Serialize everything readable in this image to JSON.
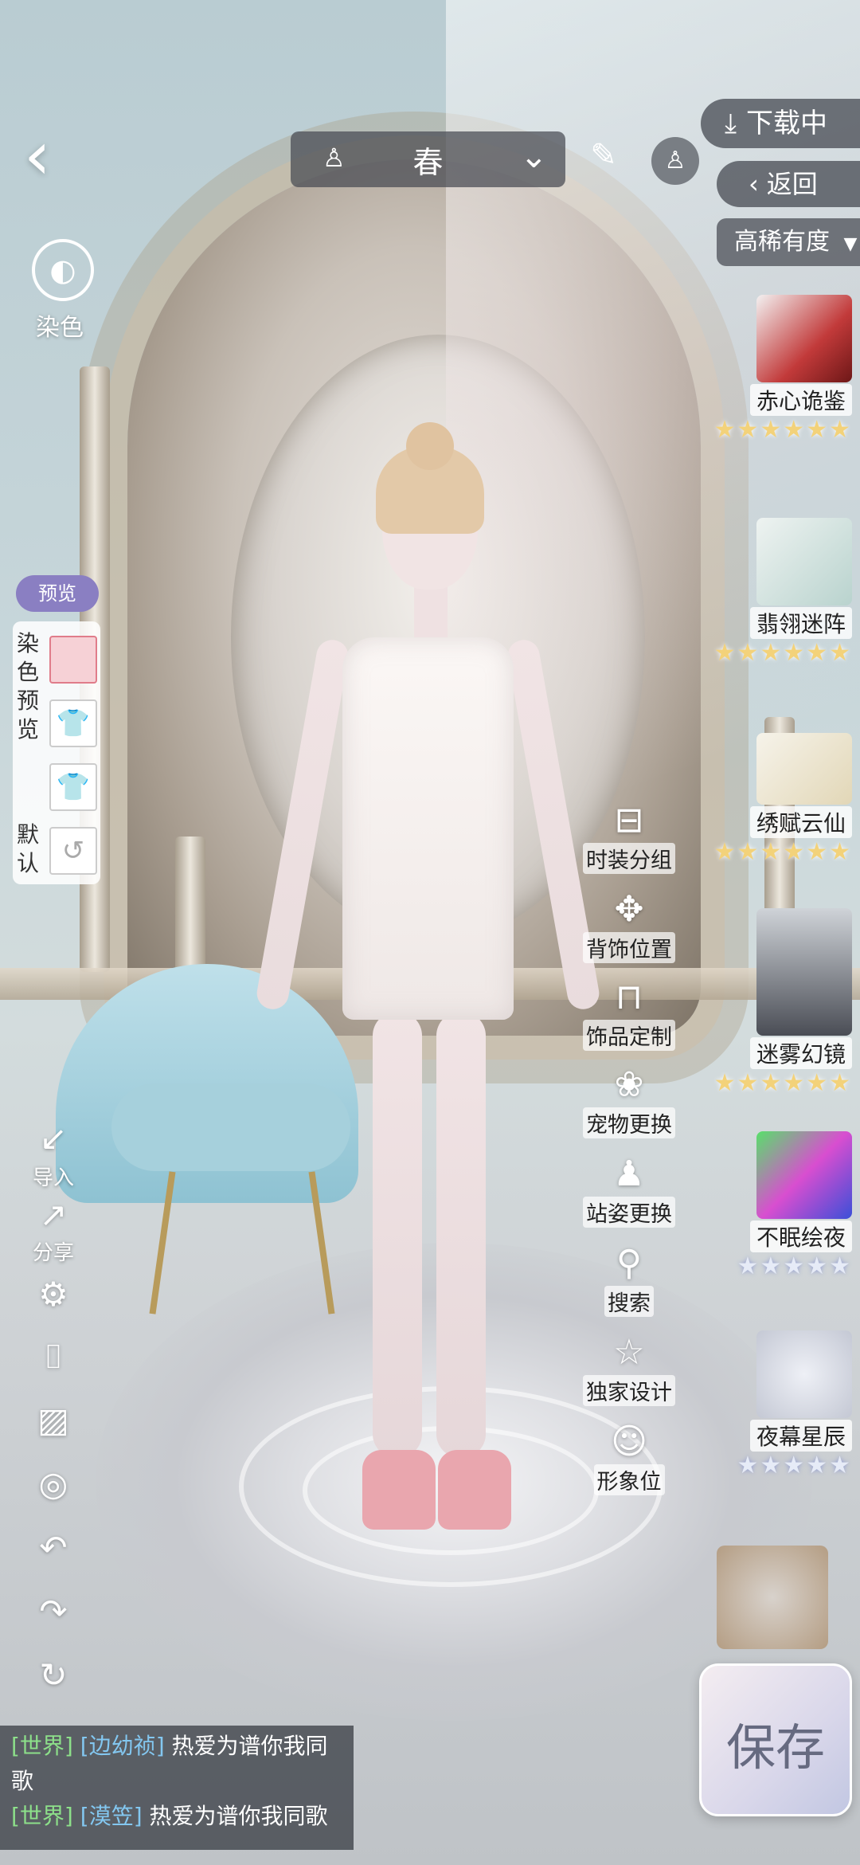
{
  "top_bar": {
    "season": "春",
    "download_label": "下载中",
    "return_label": "返回",
    "rarity_label": "高稀有度"
  },
  "left_tools": {
    "dye_label": "染色",
    "preview_label": "预览",
    "dye_preview_label": "染色预览",
    "default_label": "默认",
    "import_label": "导入",
    "share_label": "分享"
  },
  "center_menu": [
    {
      "label": "时装分组",
      "icon": "hanger-icon"
    },
    {
      "label": "背饰位置",
      "icon": "wing-position-icon"
    },
    {
      "label": "饰品定制",
      "icon": "bag-icon"
    },
    {
      "label": "宠物更换",
      "icon": "paw-icon"
    },
    {
      "label": "站姿更换",
      "icon": "person-icon"
    },
    {
      "label": "搜索",
      "icon": "search-icon"
    },
    {
      "label": "独家设计",
      "icon": "star-icon"
    },
    {
      "label": "形象位",
      "icon": "portrait-icon"
    }
  ],
  "collections": [
    {
      "name": "赤心诡鉴",
      "stars": "★★★★★★",
      "tier": "gold"
    },
    {
      "name": "翡翎迷阵",
      "stars": "★★★★★★",
      "tier": "gold"
    },
    {
      "name": "绣赋云仙",
      "stars": "★★★★★★",
      "tier": "gold"
    },
    {
      "name": "迷雾幻镜",
      "stars": "★★★★★★",
      "tier": "gold"
    },
    {
      "name": "不眠绘夜",
      "stars": "★★★★★",
      "tier": "silver"
    },
    {
      "name": "夜幕星辰",
      "stars": "★★★★★",
      "tier": "silver"
    }
  ],
  "save_label": "保存",
  "chat": [
    {
      "channel": "[世界]",
      "user": "[边幼祯]",
      "message": "热爱为谱你我同歌"
    },
    {
      "channel": "[世界]",
      "user": "[漠笠]",
      "message": "热爱为谱你我同歌"
    }
  ],
  "colors": {
    "gold_star": "#f3d27a",
    "silver_star": "#e6ebf7",
    "chat_channel": "#8de08a",
    "chat_user": "#83c7f0",
    "preview_pill": "#8a7fc2"
  }
}
